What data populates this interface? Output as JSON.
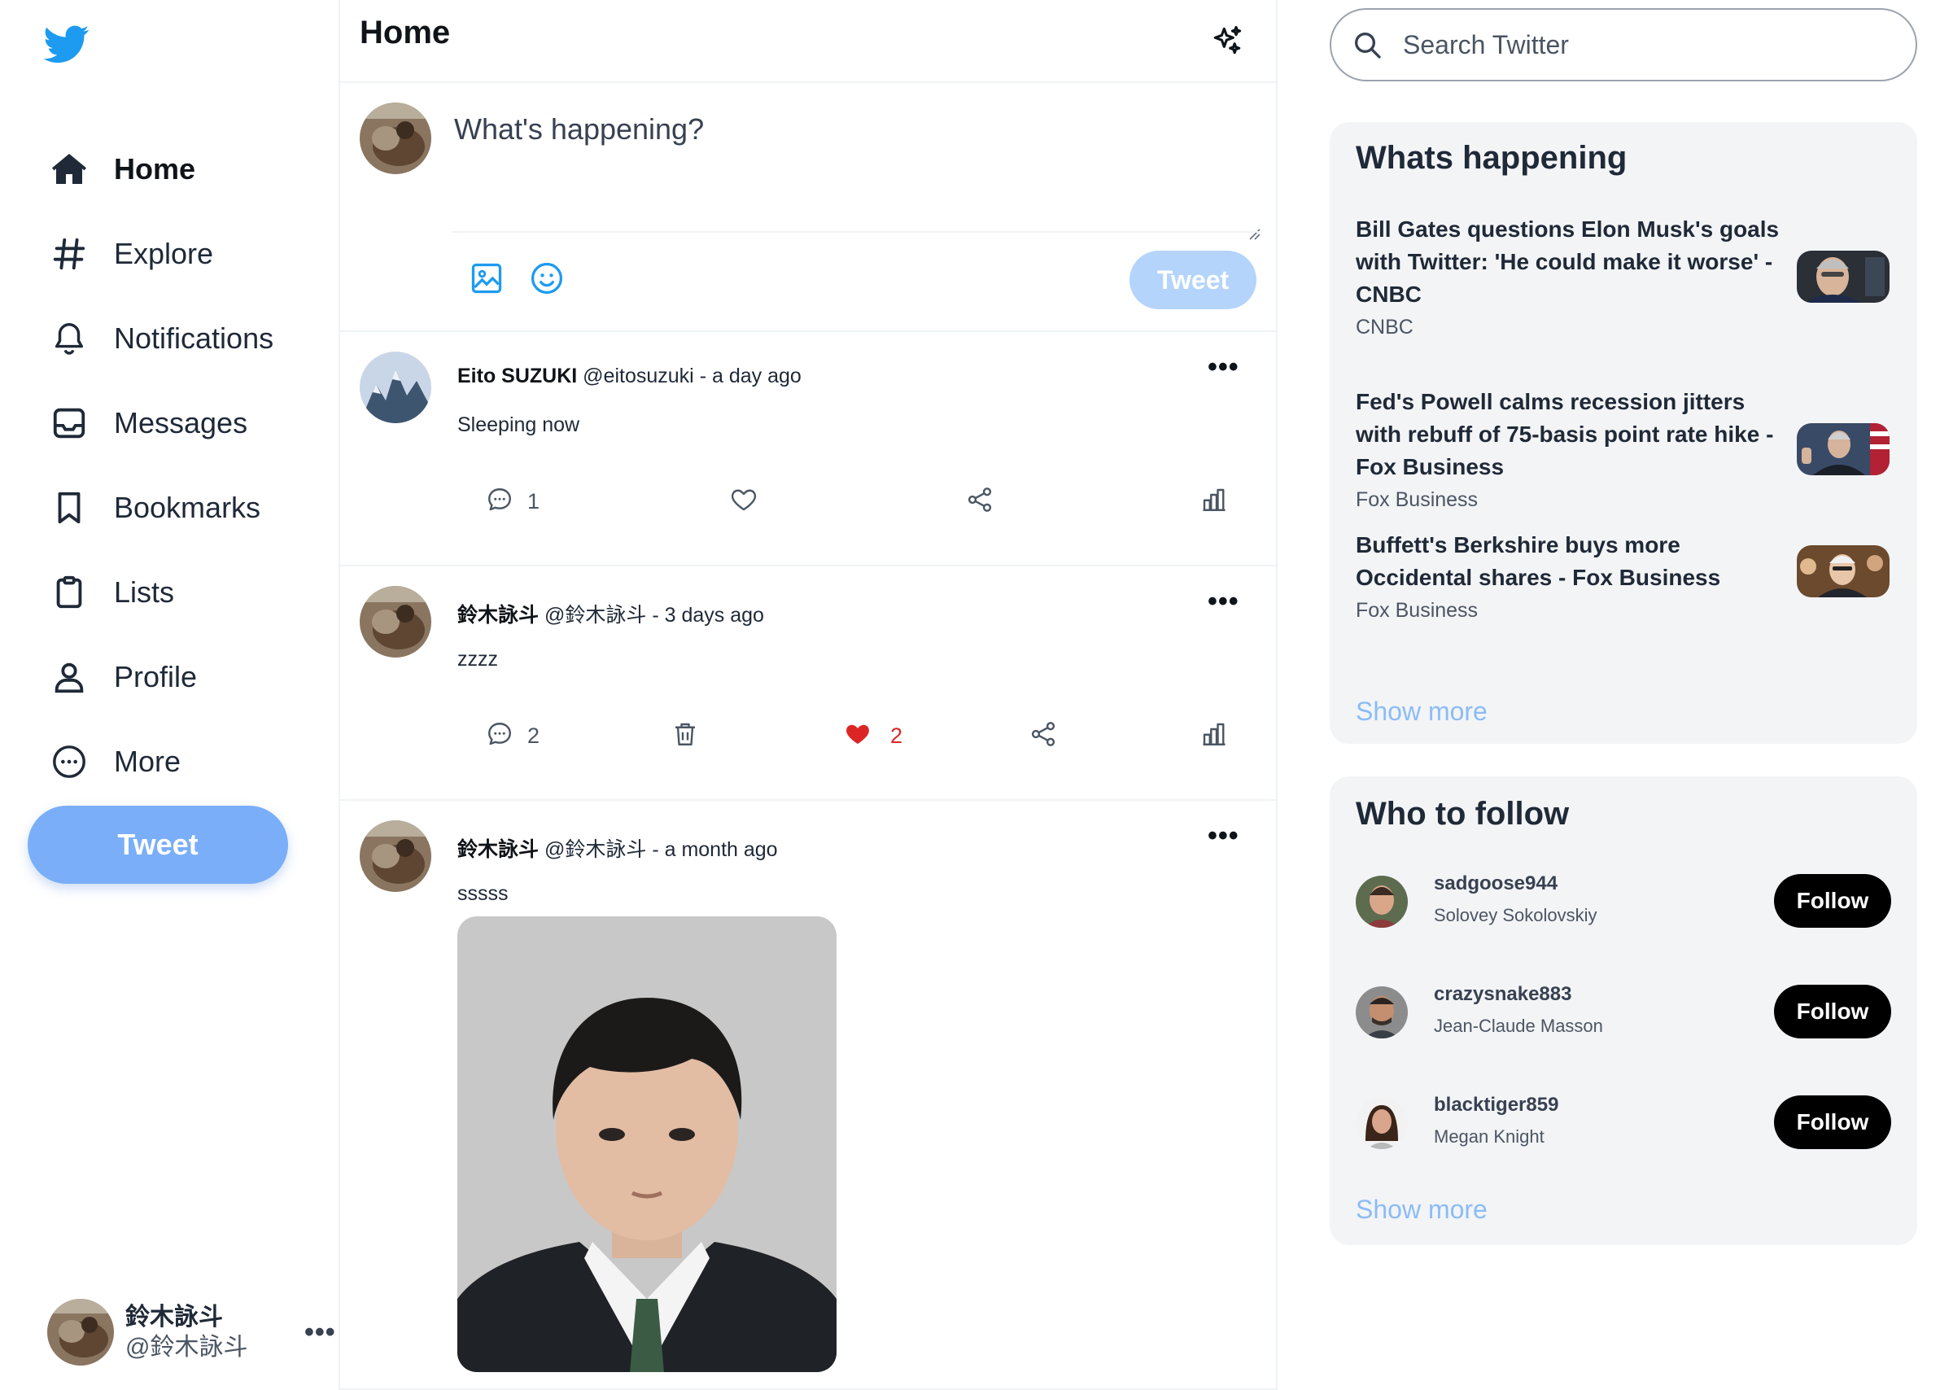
{
  "sidebar": {
    "items": [
      {
        "label": "Home",
        "icon": "home-icon"
      },
      {
        "label": "Explore",
        "icon": "hashtag-icon"
      },
      {
        "label": "Notifications",
        "icon": "bell-icon"
      },
      {
        "label": "Messages",
        "icon": "inbox-icon"
      },
      {
        "label": "Bookmarks",
        "icon": "bookmark-icon"
      },
      {
        "label": "Lists",
        "icon": "clipboard-icon"
      },
      {
        "label": "Profile",
        "icon": "user-icon"
      },
      {
        "label": "More",
        "icon": "ellipsis-circle-icon"
      }
    ],
    "tweet_label": "Tweet",
    "account": {
      "name": "鈴木詠斗",
      "handle": "@鈴木詠斗",
      "more": "•••"
    }
  },
  "main": {
    "title": "Home",
    "composer": {
      "placeholder": "What's happening?",
      "tweet_label": "Tweet"
    },
    "posts": [
      {
        "name": "Eito SUZUKI",
        "handle": "@eitosuzuki",
        "time": "a day ago",
        "text": "Sleeping now",
        "comments": "1",
        "likes": "",
        "more": "•••"
      },
      {
        "name": "鈴木詠斗",
        "handle": "@鈴木詠斗",
        "time": "3 days ago",
        "text": "zzzz",
        "comments": "2",
        "likes": "2",
        "more": "•••"
      },
      {
        "name": "鈴木詠斗",
        "handle": "@鈴木詠斗",
        "time": "a month ago",
        "text": "sssss",
        "more": "•••"
      }
    ]
  },
  "right": {
    "search_placeholder": "Search Twitter",
    "happening": {
      "title": "Whats happening",
      "items": [
        {
          "title": "Bill Gates questions Elon Musk's goals with Twitter: 'He could make it worse' - CNBC",
          "source": "CNBC"
        },
        {
          "title": "Fed's Powell calms recession jitters with rebuff of 75-basis point rate hike - Fox Business",
          "source": "Fox Business"
        },
        {
          "title": "Buffett's Berkshire buys more Occidental shares - Fox Business",
          "source": "Fox Business"
        }
      ],
      "show_more": "Show more"
    },
    "follow": {
      "title": "Who to follow",
      "items": [
        {
          "username": "sadgoose944",
          "name": "Solovey Sokolovskiy",
          "button": "Follow"
        },
        {
          "username": "crazysnake883",
          "name": "Jean-Claude Masson",
          "button": "Follow"
        },
        {
          "username": "blacktiger859",
          "name": "Megan Knight",
          "button": "Follow"
        }
      ],
      "show_more": "Show more"
    }
  },
  "colors": {
    "accent": "#1d9bf0",
    "tweet_button": "#7aaef8",
    "like": "#dc2626",
    "show_more": "#8bbcf6"
  }
}
